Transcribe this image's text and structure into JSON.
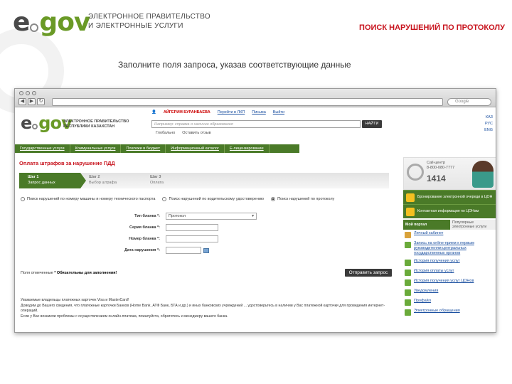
{
  "slide": {
    "logo_e": "e",
    "logo_gov": "gov",
    "org_line1": "ЭЛЕКТРОННОЕ ПРАВИТЕЛЬСТВО",
    "org_line2": "И ЭЛЕКТРОННЫЕ УСЛУГИ",
    "title": "ПОИСК НАРУШЕНИЙ ПО ПРОТОКОЛУ",
    "subtitle": "Заполните поля запроса, указав соответствующие данные"
  },
  "browser": {
    "search_placeholder": "Google"
  },
  "site": {
    "logo_e": "e",
    "logo_gov": "gov",
    "org_line1": "ЭЛЕКТРОННОЕ ПРАВИТЕЛЬСТВО",
    "org_line2": "РЕСПУБЛИКИ КАЗАХСТАН",
    "user_name": "АЙГЕРИМ БУРАНБАЕВА",
    "user_links": [
      "Перейти в ЛКП",
      "Письма",
      "Выйти"
    ],
    "search_placeholder": "Например: справка о наличии образования",
    "find_label": "НАЙТИ",
    "search_opts": [
      "Глобально",
      "Оставить отзыв"
    ],
    "languages": [
      "КАЗ",
      "РУС",
      "ENG"
    ],
    "nav": [
      "Государственные услуги",
      "Коммунальные услуги",
      "Платежи в бюджет",
      "Информационный каталог",
      "Е-лицензирование"
    ]
  },
  "form": {
    "title": "Оплата штрафов за нарушение ПДД",
    "steps": [
      {
        "num": "Шаг 1",
        "label": "Запрос данных"
      },
      {
        "num": "Шаг 2",
        "label": "Выбор штрафа"
      },
      {
        "num": "Шаг 3",
        "label": "Оплата"
      }
    ],
    "search_modes": [
      "Поиск нарушений по номеру машины и номеру технического паспорта",
      "Поиск нарушений по водительскому удостоверению",
      "Поиск нарушений по протоколу"
    ],
    "fields": [
      {
        "label": "Тип бланка *:",
        "value": "Протокол"
      },
      {
        "label": "Серия бланка *:",
        "value": ""
      },
      {
        "label": "Номер бланка *:",
        "value": ""
      },
      {
        "label": "Дата нарушения *:",
        "value": ""
      }
    ],
    "required_note_pre": "Поля отмеченные ",
    "required_note_bold": "* Обязательны для заполнения!",
    "submit_label": "Отправить запрос",
    "footnote": [
      "Уважаемые владельцы платежных карточек Visa и MasterCard!",
      "Доводим до Вашего сведения, что платежные карточки Банков (Homе Bank, АТФ Банк, БТА и др.) и иных банковских учреждений ... удостоверьтесь в наличии у Вас платежной карточки для проведения интернет-операций.",
      "Если у Вас возникли проблемы с осуществлением онлайн-платежа, пожалуйста, обратитесь к менеджеру вашего банка."
    ]
  },
  "sidebar": {
    "callcenter_label": "Call-центр",
    "callcenter_phone": "8-800-080-7777",
    "short_number": "1414",
    "promos": [
      "Бронирование электронной очереди в ЦОН",
      "Контактная информация по ЦОНам"
    ],
    "tab_on": "Мой портал",
    "tab_off": "Популярные электронные услуги",
    "services": [
      {
        "label": "Личный кабинет",
        "color": "#d9a23a"
      },
      {
        "label": "Запись на online-прием к первым руководителям центральных государственных органов",
        "color": "#6aaa3a"
      },
      {
        "label": "История получения услуг",
        "color": "#6aaa3a"
      },
      {
        "label": "История оплаты услуг",
        "color": "#6aaa3a"
      },
      {
        "label": "История получения услуг ЦОНов",
        "color": "#6aaa3a"
      },
      {
        "label": "Уведомления",
        "color": "#6aaa3a"
      },
      {
        "label": "Профайл",
        "color": "#6aaa3a"
      },
      {
        "label": "Электронные обращения",
        "color": "#6aaa3a"
      }
    ]
  }
}
